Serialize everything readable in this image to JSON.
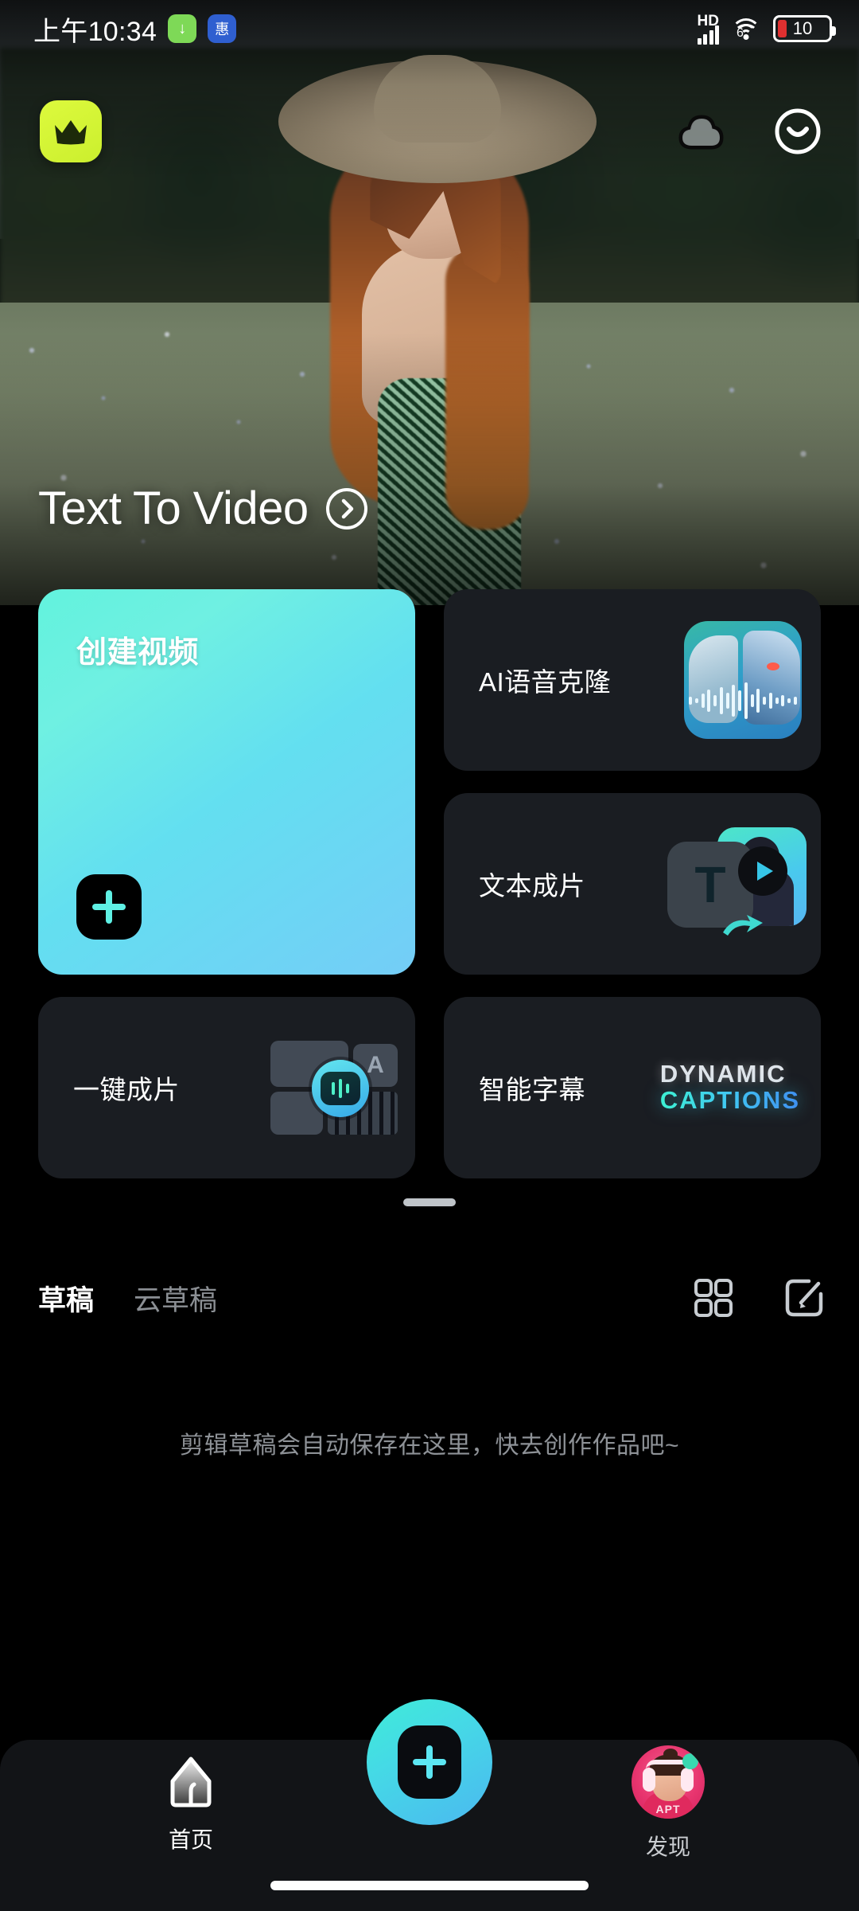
{
  "status_bar": {
    "time": "上午10:34",
    "download_badge": "↓",
    "app_badge": "惠",
    "network_label": "HD",
    "wifi_generation": "6",
    "battery_percent": "10"
  },
  "hero": {
    "crown_icon": "crown-icon",
    "cloud_icon": "cloud-icon",
    "profile_icon": "smiley-face-icon",
    "banner_title": "Text To Video",
    "banner_arrow": "chevron-right-circle-icon"
  },
  "cards": {
    "create_video": {
      "title": "创建视频",
      "action_icon": "plus-icon"
    },
    "voice_clone": {
      "title": "AI语音克隆",
      "thumb": "ai-voice-clone-thumbnail"
    },
    "text_to_film": {
      "title": "文本成片",
      "thumb": "text-to-film-thumbnail"
    },
    "one_tap_film": {
      "title": "一键成片",
      "thumb": "one-tap-film-thumbnail"
    },
    "smart_captions": {
      "title": "智能字幕",
      "thumb_line1": "DYNAMIC",
      "thumb_line2": "CAPTIONS"
    }
  },
  "drafts": {
    "tabs": [
      {
        "label": "草稿",
        "active": true
      },
      {
        "label": "云草稿",
        "active": false
      }
    ],
    "grid_icon": "grid-view-icon",
    "edit_icon": "edit-compose-icon",
    "empty_text": "剪辑草稿会自动保存在这里，快去创作作品吧~"
  },
  "bottom_nav": {
    "home": {
      "label": "首页",
      "icon": "home-icon"
    },
    "create": {
      "icon": "plus-icon"
    },
    "discover": {
      "label": "发现",
      "icon": "avatar-icon",
      "avatar_text": "APT"
    }
  },
  "colors": {
    "accent_mint": "#3FECD8",
    "accent_blue": "#4BB8F0",
    "crown_lime": "#D9F53C",
    "card_bg": "#1A1D22",
    "page_bg": "#000000",
    "battery_red": "#E03030",
    "avatar_pink": "#E8356F"
  }
}
